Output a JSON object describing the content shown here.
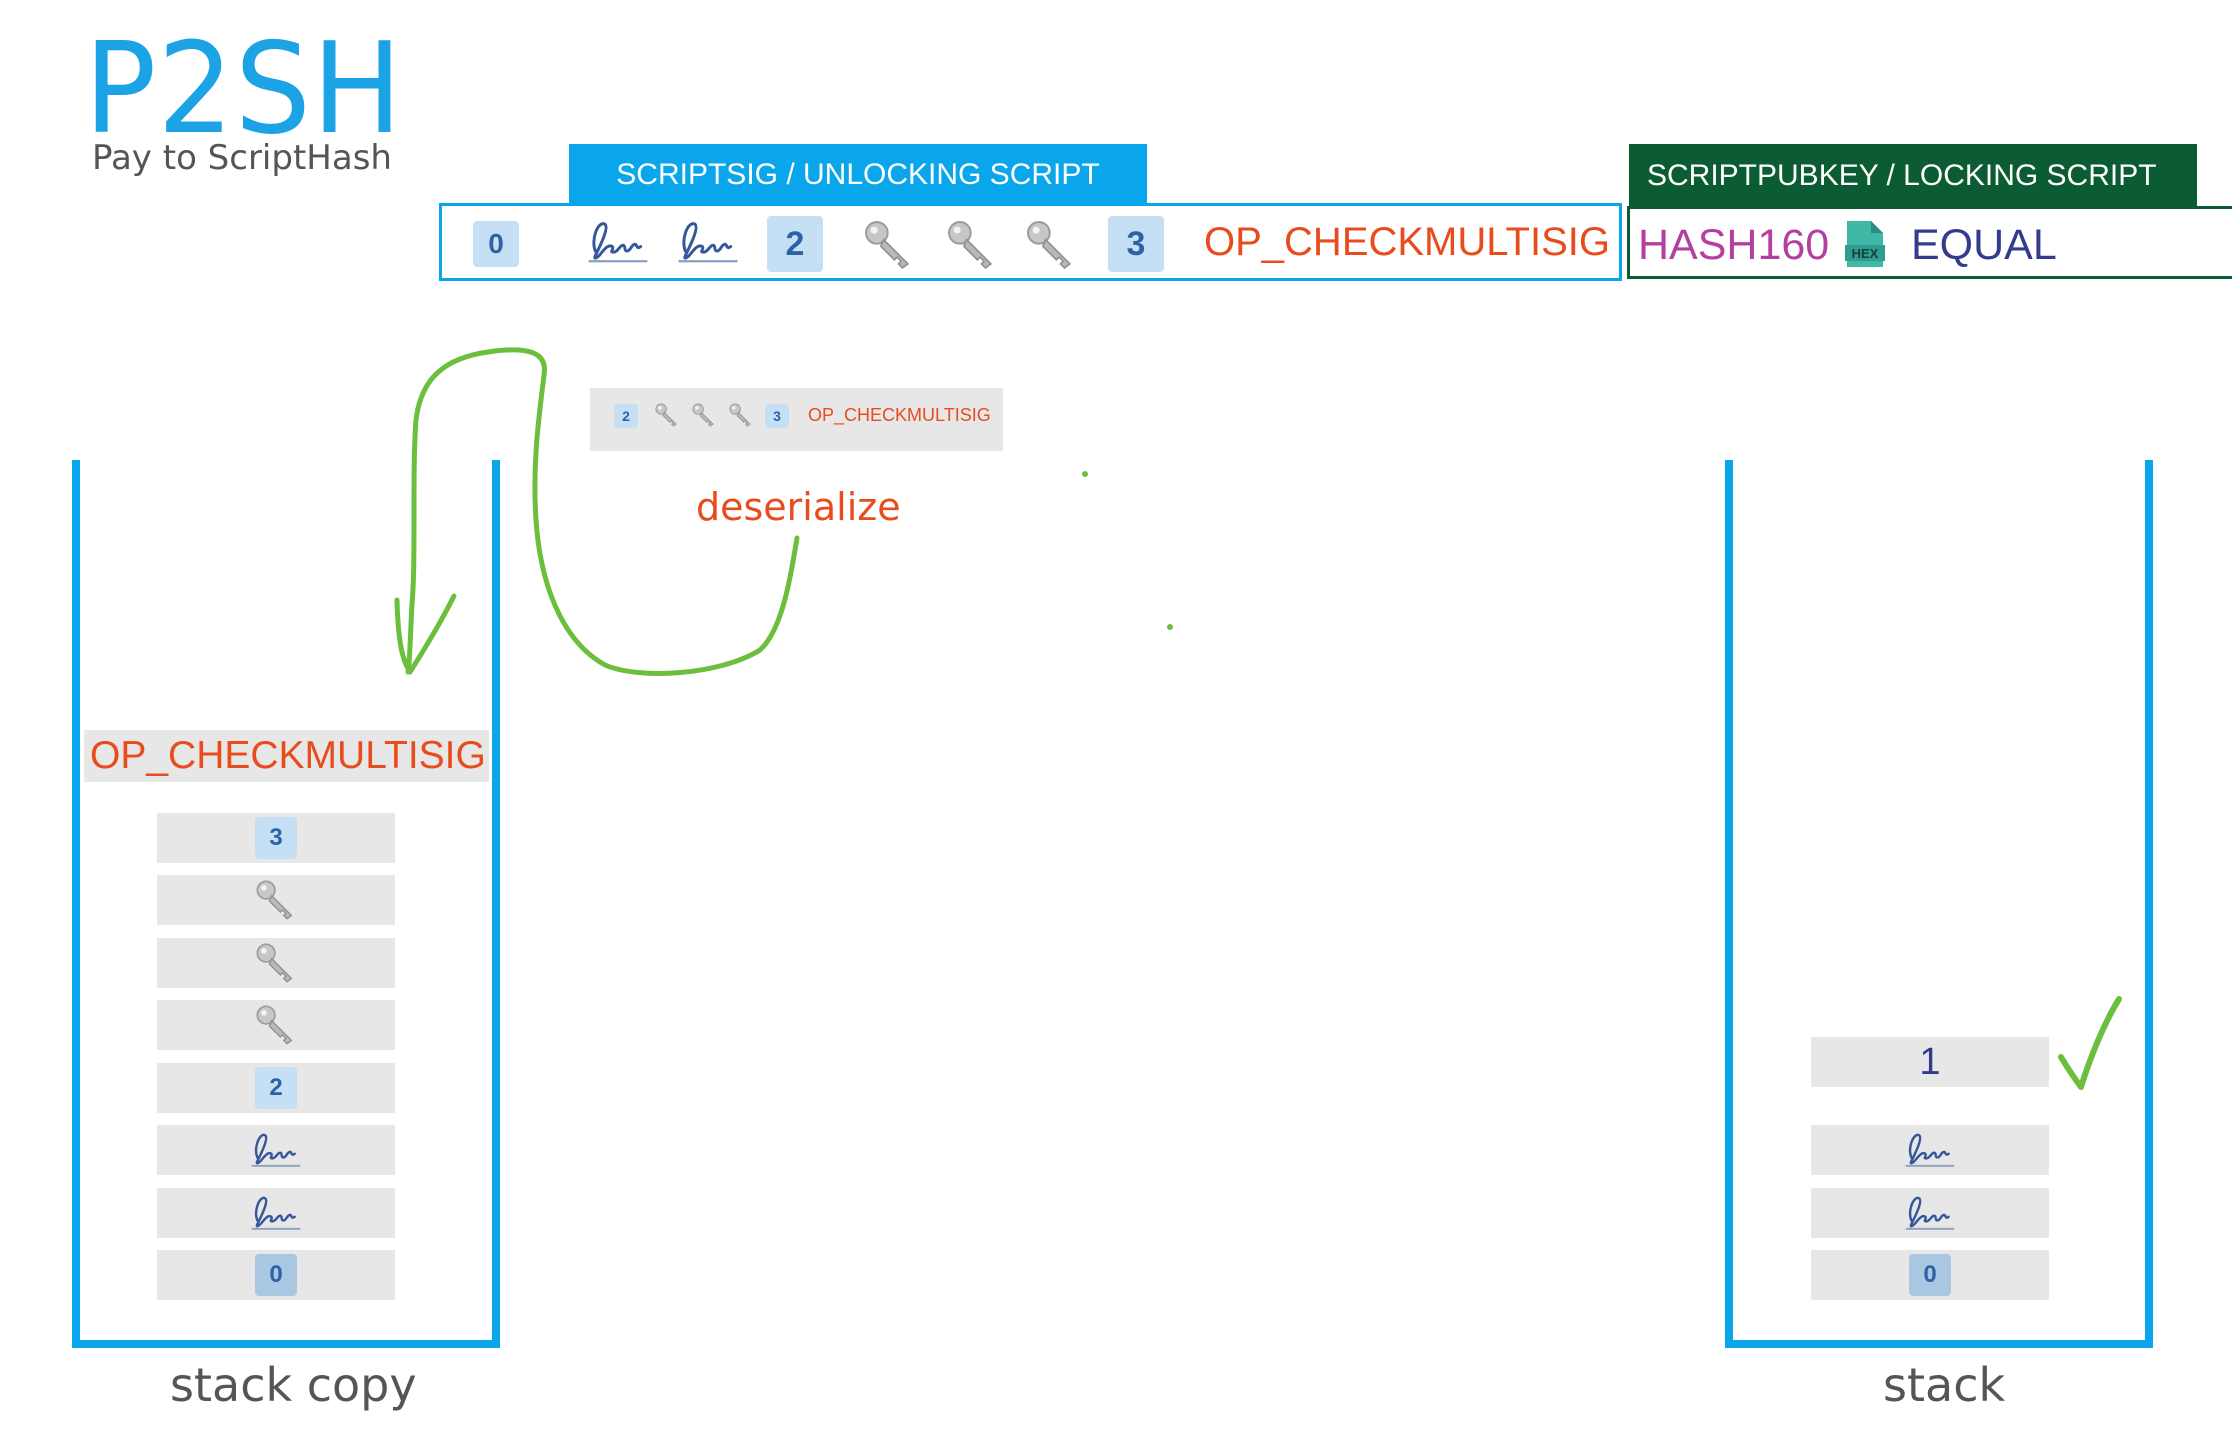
{
  "title": "P2SH",
  "subtitle": "Pay to ScriptHash",
  "scriptsig": {
    "header": "SCRIPTSIG / UNLOCKING SCRIPT",
    "items": [
      "0",
      "sig",
      "sig",
      "2",
      "key",
      "key",
      "key",
      "3",
      "OP_CHECKMULTISIG"
    ],
    "zero": "0",
    "m": "2",
    "n": "3",
    "op": "OP_CHECKMULTISIG"
  },
  "scriptpubkey": {
    "header": "SCRIPTPUBKEY /  LOCKING SCRIPT",
    "hash": "HASH160",
    "hex_icon": "HEX",
    "equal": "EQUAL"
  },
  "redeem_script": {
    "m": "2",
    "n": "3",
    "op": "OP_CHECKMULTISIG",
    "action": "deserialize"
  },
  "stack_copy": {
    "label": "stack copy",
    "op": "OP_CHECKMULTISIG",
    "cells": [
      "3",
      "key",
      "key",
      "key",
      "2",
      "sig",
      "sig",
      "0"
    ]
  },
  "stack": {
    "label": "stack",
    "cells": [
      "1",
      "sig",
      "sig",
      "0"
    ],
    "top": "1",
    "bottom": "0"
  },
  "colors": {
    "accent_blue": "#0aa6ec",
    "locking_green": "#0b5c32",
    "op_orange": "#e84c1c",
    "arrow_green": "#6cbf3d"
  },
  "icons": [
    "signature-icon",
    "key-icon",
    "hex-file-icon",
    "check-icon"
  ]
}
